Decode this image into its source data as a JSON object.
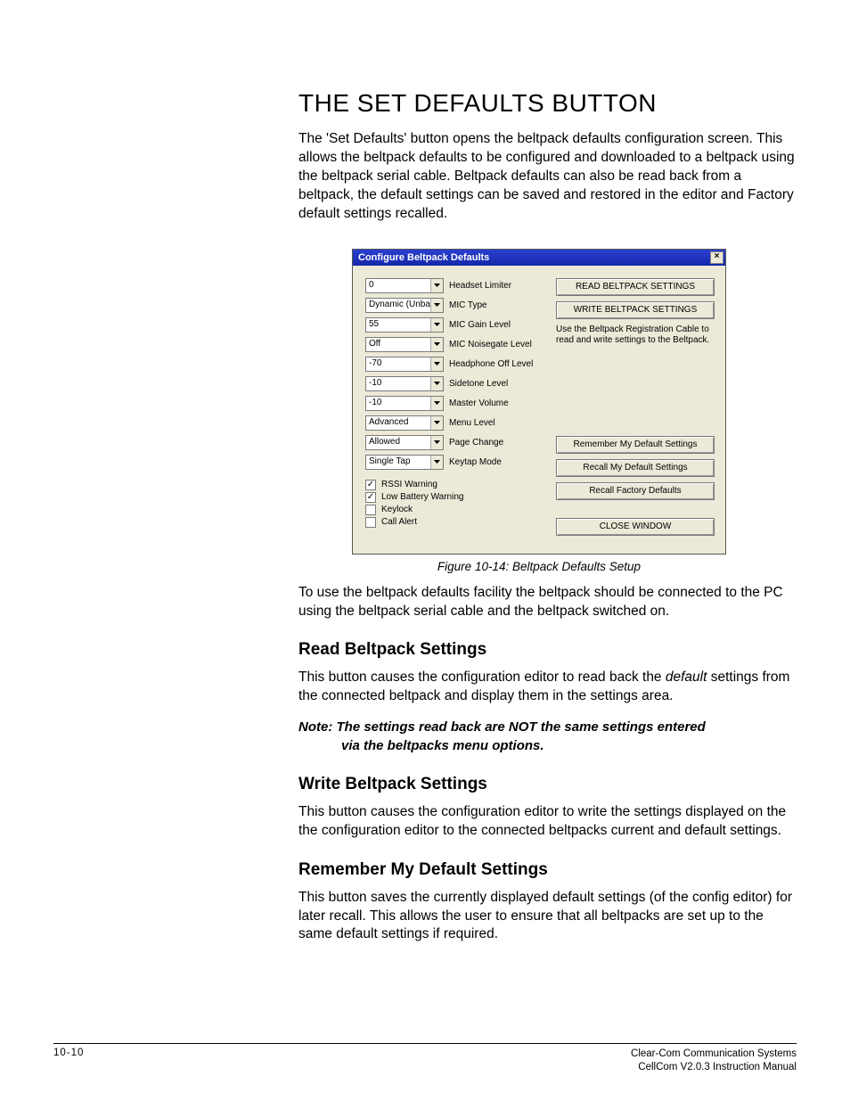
{
  "heading": "THE SET DEFAULTS BUTTON",
  "intro": "The 'Set Defaults' button opens the beltpack defaults configuration screen.  This allows the beltpack defaults to be configured and downloaded to a beltpack using the beltpack serial cable.  Beltpack defaults can also be read back from a beltpack, the default settings can be saved and restored in the editor and Factory default settings recalled.",
  "dialog": {
    "title": "Configure Beltpack Defaults",
    "close": "×",
    "fields": [
      {
        "value": "0",
        "label": "Headset Limiter"
      },
      {
        "value": "Dynamic (Unbalan",
        "label": "MIC Type"
      },
      {
        "value": "55",
        "label": "MIC Gain Level"
      },
      {
        "value": "Off",
        "label": "MIC Noisegate Level"
      },
      {
        "value": "-70",
        "label": "Headphone Off Level"
      },
      {
        "value": "-10",
        "label": "Sidetone Level"
      },
      {
        "value": "-10",
        "label": "Master Volume"
      },
      {
        "value": "Advanced",
        "label": "Menu Level"
      },
      {
        "value": "Allowed",
        "label": "Page Change"
      },
      {
        "value": "Single Tap",
        "label": "Keytap Mode"
      }
    ],
    "checks": [
      {
        "checked": true,
        "label": "RSSI Warning"
      },
      {
        "checked": true,
        "label": "Low Battery Warning"
      },
      {
        "checked": false,
        "label": "Keylock"
      },
      {
        "checked": false,
        "label": "Call Alert"
      }
    ],
    "right": {
      "read": "READ BELTPACK SETTINGS",
      "write": "WRITE BELTPACK SETTINGS",
      "hint": "Use the Beltpack Registration Cable to read and write settings to the Beltpack.",
      "remember": "Remember My Default Settings",
      "recall": "Recall My Default Settings",
      "factory": "Recall Factory Defaults",
      "close": "CLOSE WINDOW"
    }
  },
  "caption": "Figure 10-14: Beltpack Defaults Setup",
  "after_fig": "To use the beltpack defaults facility the beltpack should be connected to the PC using the beltpack serial cable and the beltpack switched on.",
  "sections": {
    "read": {
      "title": "Read Beltpack Settings",
      "p_before": "This button causes the configuration editor to read back the ",
      "p_em": "default",
      "p_after": " settings from the connected beltpack and display them in the settings area.",
      "note_lead": "Note: The settings read back are NOT the same settings entered",
      "note_rest": "via the beltpacks menu options."
    },
    "write": {
      "title": "Write Beltpack Settings",
      "p": "This button causes the configuration editor to write the settings displayed on the the configuration editor to the connected beltpacks current and default settings."
    },
    "remember": {
      "title": "Remember My Default Settings",
      "p": "This button saves the currently displayed default settings (of the config editor) for later recall.  This allows the user to ensure that all beltpacks are set up to the same default settings if required."
    }
  },
  "footer": {
    "page": "10-10",
    "r1": "Clear-Com Communication Systems",
    "r2": "CellCom V2.0.3 Instruction Manual"
  }
}
